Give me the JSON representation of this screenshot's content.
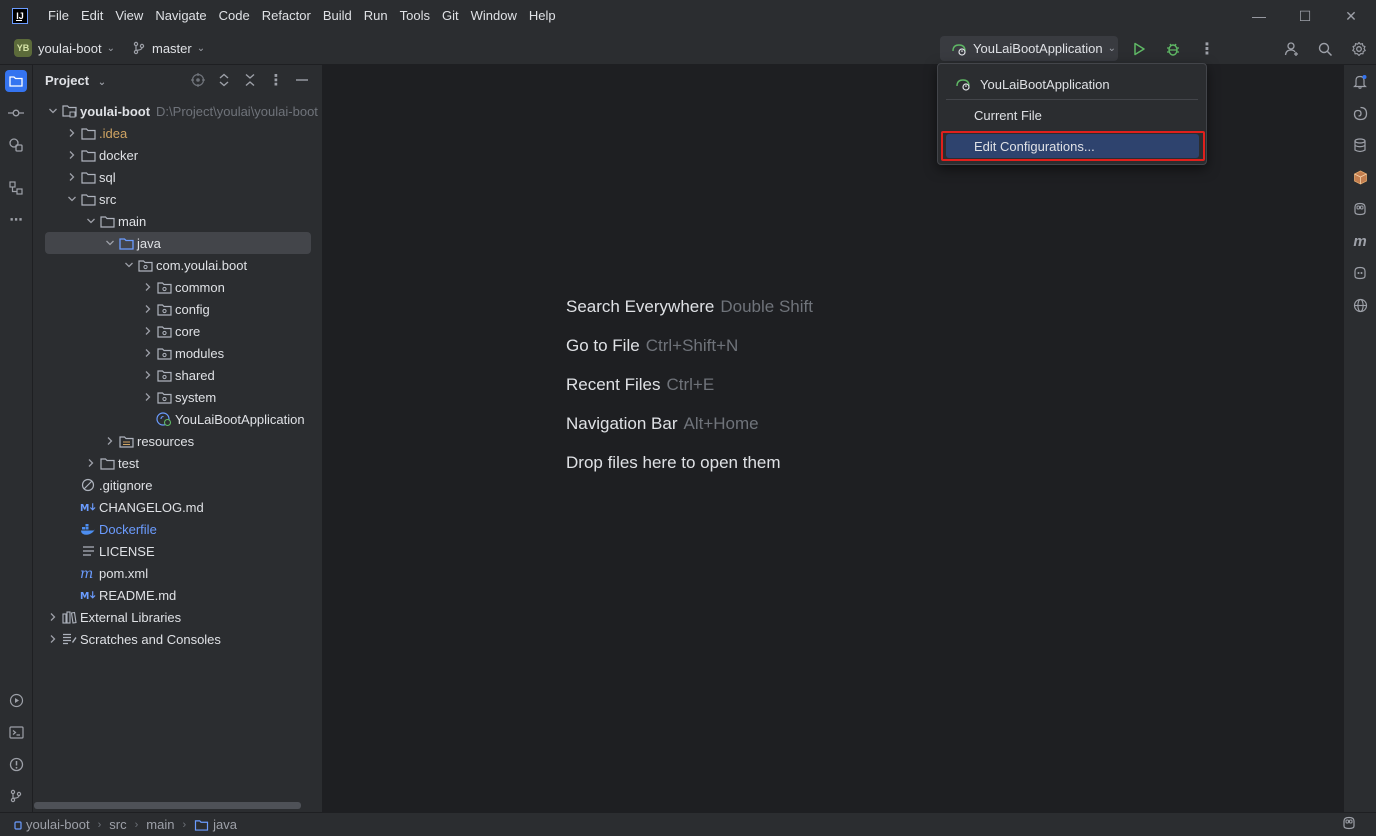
{
  "menu": [
    "File",
    "Edit",
    "View",
    "Navigate",
    "Code",
    "Refactor",
    "Build",
    "Run",
    "Tools",
    "Git",
    "Window",
    "Help"
  ],
  "toolbar": {
    "project_badge": "YB",
    "project_name": "youlai-boot",
    "branch": "master",
    "run_config": "YouLaiBootApplication"
  },
  "project_panel": {
    "title": "Project",
    "tree": [
      {
        "label": "youlai-boot",
        "hint": "D:\\Project\\youlai\\youlai-boot",
        "depth": 0,
        "expanded": true,
        "icon": "module-folder-icon",
        "style": "bold"
      },
      {
        "label": ".idea",
        "depth": 1,
        "expanded": false,
        "icon": "folder-icon",
        "style": "orange"
      },
      {
        "label": "docker",
        "depth": 1,
        "expanded": false,
        "icon": "folder-icon"
      },
      {
        "label": "sql",
        "depth": 1,
        "expanded": false,
        "icon": "folder-icon"
      },
      {
        "label": "src",
        "depth": 1,
        "expanded": true,
        "icon": "folder-icon"
      },
      {
        "label": "main",
        "depth": 2,
        "expanded": true,
        "icon": "folder-icon"
      },
      {
        "label": "java",
        "depth": 3,
        "expanded": true,
        "icon": "source-folder-icon",
        "selected": true
      },
      {
        "label": "com.youlai.boot",
        "depth": 4,
        "expanded": true,
        "icon": "package-icon"
      },
      {
        "label": "common",
        "depth": 5,
        "expanded": false,
        "icon": "package-icon"
      },
      {
        "label": "config",
        "depth": 5,
        "expanded": false,
        "icon": "package-icon"
      },
      {
        "label": "core",
        "depth": 5,
        "expanded": false,
        "icon": "package-icon"
      },
      {
        "label": "modules",
        "depth": 5,
        "expanded": false,
        "icon": "package-icon"
      },
      {
        "label": "shared",
        "depth": 5,
        "expanded": false,
        "icon": "package-icon"
      },
      {
        "label": "system",
        "depth": 5,
        "expanded": false,
        "icon": "package-icon"
      },
      {
        "label": "YouLaiBootApplication",
        "depth": 5,
        "leaf": true,
        "icon": "spring-boot-class-icon"
      },
      {
        "label": "resources",
        "depth": 3,
        "expanded": false,
        "icon": "resources-folder-icon"
      },
      {
        "label": "test",
        "depth": 2,
        "expanded": false,
        "icon": "folder-icon"
      },
      {
        "label": ".gitignore",
        "depth": 1,
        "leaf": true,
        "icon": "gitignore-icon"
      },
      {
        "label": "CHANGELOG.md",
        "depth": 1,
        "leaf": true,
        "icon": "markdown-icon"
      },
      {
        "label": "Dockerfile",
        "depth": 1,
        "leaf": true,
        "icon": "docker-icon",
        "style": "blue"
      },
      {
        "label": "LICENSE",
        "depth": 1,
        "leaf": true,
        "icon": "text-file-icon"
      },
      {
        "label": "pom.xml",
        "depth": 1,
        "leaf": true,
        "icon": "maven-icon"
      },
      {
        "label": "README.md",
        "depth": 1,
        "leaf": true,
        "icon": "markdown-icon"
      },
      {
        "label": "External Libraries",
        "depth": 0,
        "expanded": false,
        "icon": "libraries-icon"
      },
      {
        "label": "Scratches and Consoles",
        "depth": 0,
        "expanded": false,
        "icon": "scratches-icon"
      }
    ]
  },
  "editor_hints": [
    {
      "action": "Search Everywhere",
      "shortcut": "Double Shift"
    },
    {
      "action": "Go to File",
      "shortcut": "Ctrl+Shift+N"
    },
    {
      "action": "Recent Files",
      "shortcut": "Ctrl+E"
    },
    {
      "action": "Navigation Bar",
      "shortcut": "Alt+Home"
    },
    {
      "action": "Drop files here to open them",
      "shortcut": ""
    }
  ],
  "run_popup": {
    "items": [
      "YouLaiBootApplication",
      "Current File",
      "Edit Configurations..."
    ],
    "selected": "Edit Configurations..."
  },
  "breadcrumb": [
    "youlai-boot",
    "src",
    "main",
    "java"
  ],
  "colors": {
    "accent": "#3574f0",
    "highlight_border": "#e0201c",
    "selection": "#2e436e"
  }
}
